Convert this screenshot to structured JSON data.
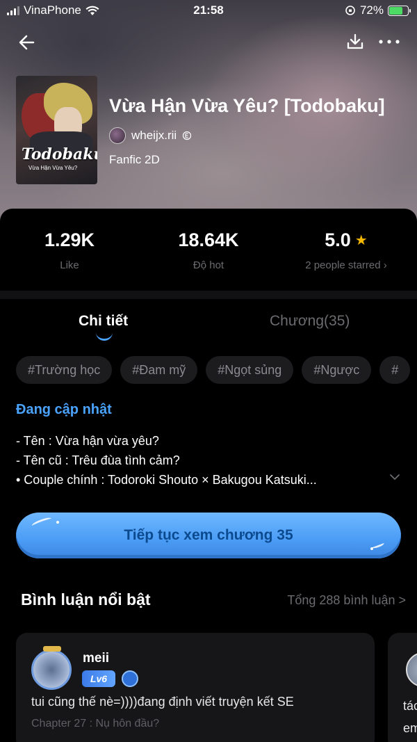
{
  "status_bar": {
    "carrier": "VinaPhone",
    "time": "21:58",
    "battery_percent": "72%",
    "battery_level": 0.72
  },
  "book": {
    "title": "Vừa Hận Vừa Yêu? [Todobaku]",
    "author": "wheijx.rii",
    "genre": "Fanfic 2D",
    "cover_title": "Todobaku",
    "cover_subtitle": "Vừa Hận Vừa Yêu?"
  },
  "stats": [
    {
      "value": "1.29K",
      "label": "Like"
    },
    {
      "value": "18.64K",
      "label": "Độ hot"
    },
    {
      "value": "5.0",
      "label": "2 people starred ›"
    }
  ],
  "tabs": {
    "details": "Chi tiết",
    "chapters": "Chương(35)"
  },
  "tags": [
    "#Trường học",
    "#Đam mỹ",
    "#Ngọt sủng",
    "#Ngược",
    "#"
  ],
  "update_status": "Đang cập nhật",
  "description": [
    "- Tên : Vừa hận vừa yêu?",
    "- Tên cũ : Trêu đùa tình cảm?",
    "• Couple chính :  Todoroki Shouto × Bakugou Katsuki..."
  ],
  "continue_button": "Tiếp tục xem chương 35",
  "comments": {
    "title": "Bình luận nổi bật",
    "total": "Tổng 288 bình luận >",
    "items": [
      {
        "name": "meii",
        "level": "Lv6",
        "text": "tui cũng thế nè=))))đang định viết truyện kết SE",
        "chapter": "Chapter 27 : Nụ hôn đầu?"
      },
      {
        "text_line1": "tác",
        "text_line2": "em"
      }
    ]
  },
  "colors": {
    "accent_blue": "#4aa3ff",
    "star": "#f5b800",
    "muted_text": "#6b6b70"
  }
}
